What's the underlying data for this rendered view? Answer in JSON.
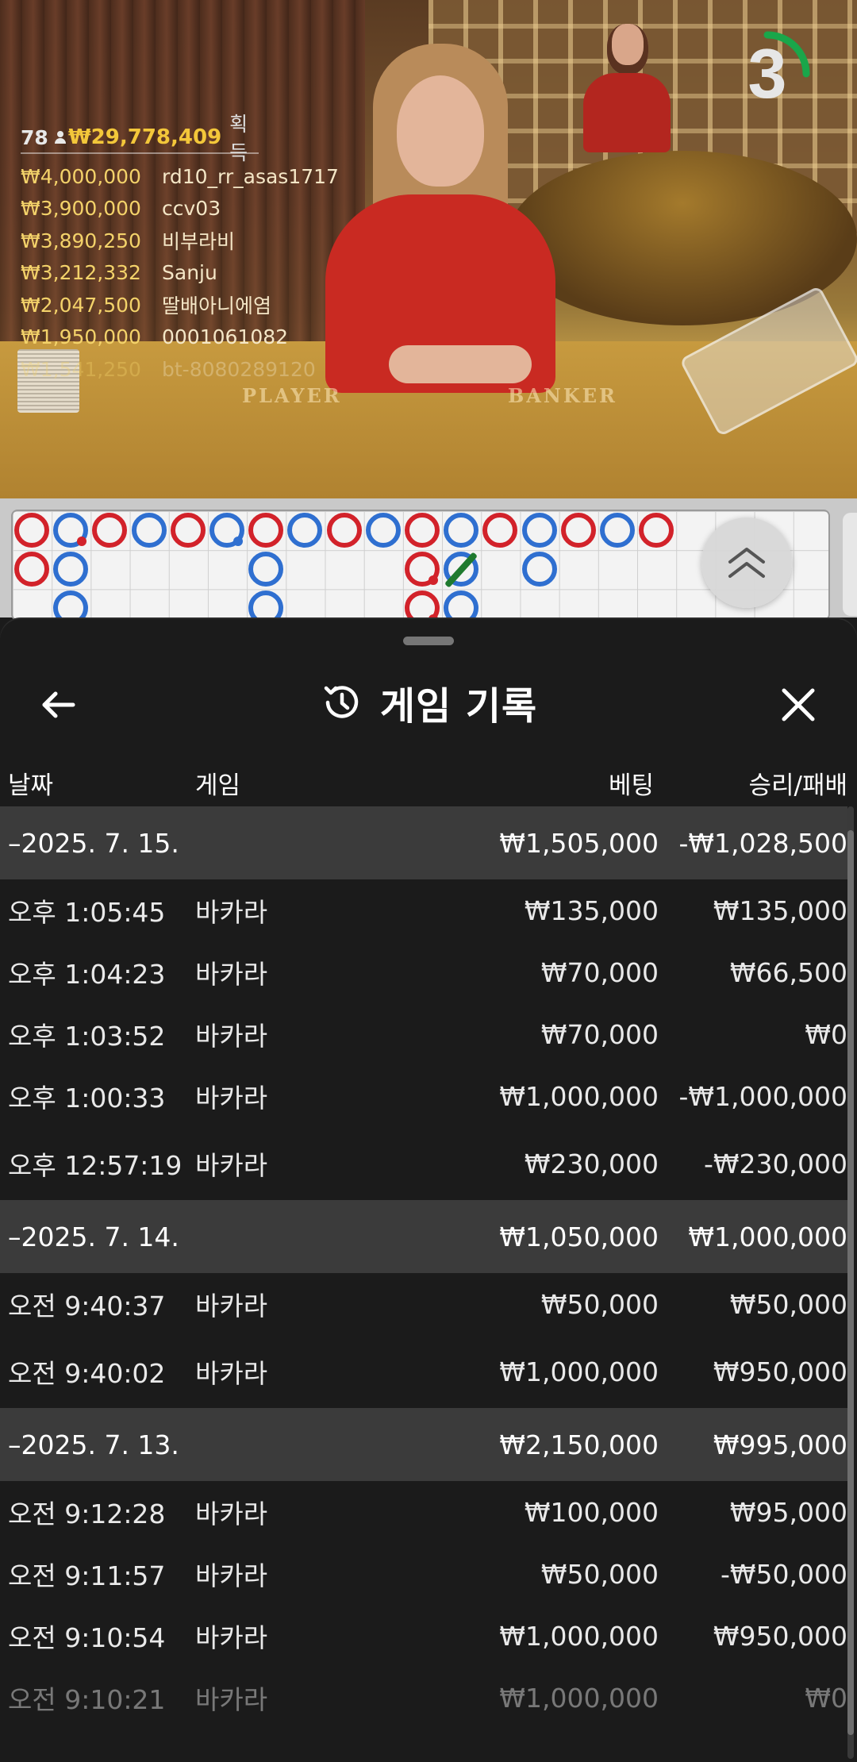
{
  "video": {
    "timer": "3",
    "table_left_label": "PLAYER",
    "table_right_label": "BANKER",
    "winners_header": {
      "count": "78",
      "total": "₩29,778,409",
      "label": "획득"
    },
    "winners": [
      {
        "amount": "₩4,000,000",
        "name": "rd10_rr_asas1717"
      },
      {
        "amount": "₩3,900,000",
        "name": "ccv03"
      },
      {
        "amount": "₩3,890,250",
        "name": "비부라비"
      },
      {
        "amount": "₩3,212,332",
        "name": "Sanju"
      },
      {
        "amount": "₩2,047,500",
        "name": "딸배아니에염"
      },
      {
        "amount": "₩1,950,000",
        "name": "0001061082"
      },
      {
        "amount": "₩1,541,250",
        "name": "bt-8080289120"
      }
    ]
  },
  "colors": {
    "banker": "#d2222a",
    "player": "#2f6fd0",
    "tie": "#1f7a2e",
    "timer_arc": "#1aa64a"
  },
  "roadmap": {
    "row1": [
      "r",
      "b",
      "r",
      "b",
      "r",
      "b",
      "r",
      "b",
      "r",
      "b",
      "r",
      "b",
      "r",
      "b",
      "r",
      "b",
      "r"
    ],
    "row2": [
      "r",
      "b",
      "",
      "",
      "",
      "",
      "b",
      "",
      "",
      "",
      "r",
      "b",
      "",
      "b"
    ],
    "row3": [
      "",
      "b",
      "",
      "",
      "",
      "",
      "b",
      "",
      "",
      "",
      "r",
      "b"
    ]
  },
  "sheet": {
    "title": "게임 기록",
    "columns": {
      "date": "날짜",
      "game": "게임",
      "bet": "베팅",
      "result": "승리/패배"
    },
    "rows": [
      {
        "type": "day",
        "time": "–2025. 7. 15.",
        "game": "",
        "bet": "₩1,505,000",
        "result": "-₩1,028,500"
      },
      {
        "type": "item",
        "time": "오후 1:05:45",
        "game": "바카라",
        "bet": "₩135,000",
        "result": "₩135,000"
      },
      {
        "type": "item",
        "time": "오후 1:04:23",
        "game": "바카라",
        "bet": "₩70,000",
        "result": "₩66,500"
      },
      {
        "type": "item",
        "time": "오후 1:03:52",
        "game": "바카라",
        "bet": "₩70,000",
        "result": "₩0"
      },
      {
        "type": "item",
        "time": "오후 1:00:33",
        "game": "바카라",
        "bet": "₩1,000,000",
        "result": "-₩1,000,000"
      },
      {
        "type": "item",
        "time": "오후 12:57:19",
        "game": "바카라",
        "bet": "₩230,000",
        "result": "-₩230,000"
      },
      {
        "type": "day",
        "time": "–2025. 7. 14.",
        "game": "",
        "bet": "₩1,050,000",
        "result": "₩1,000,000"
      },
      {
        "type": "item",
        "time": "오전 9:40:37",
        "game": "바카라",
        "bet": "₩50,000",
        "result": "₩50,000"
      },
      {
        "type": "item",
        "time": "오전 9:40:02",
        "game": "바카라",
        "bet": "₩1,000,000",
        "result": "₩950,000"
      },
      {
        "type": "day",
        "time": "–2025. 7. 13.",
        "game": "",
        "bet": "₩2,150,000",
        "result": "₩995,000"
      },
      {
        "type": "item",
        "time": "오전 9:12:28",
        "game": "바카라",
        "bet": "₩100,000",
        "result": "₩95,000"
      },
      {
        "type": "item",
        "time": "오전 9:11:57",
        "game": "바카라",
        "bet": "₩50,000",
        "result": "-₩50,000"
      },
      {
        "type": "item",
        "time": "오전 9:10:54",
        "game": "바카라",
        "bet": "₩1,000,000",
        "result": "₩950,000"
      },
      {
        "type": "item",
        "time": "오전 9:10:21",
        "game": "바카라",
        "bet": "₩1,000,000",
        "result": "₩0"
      }
    ]
  }
}
